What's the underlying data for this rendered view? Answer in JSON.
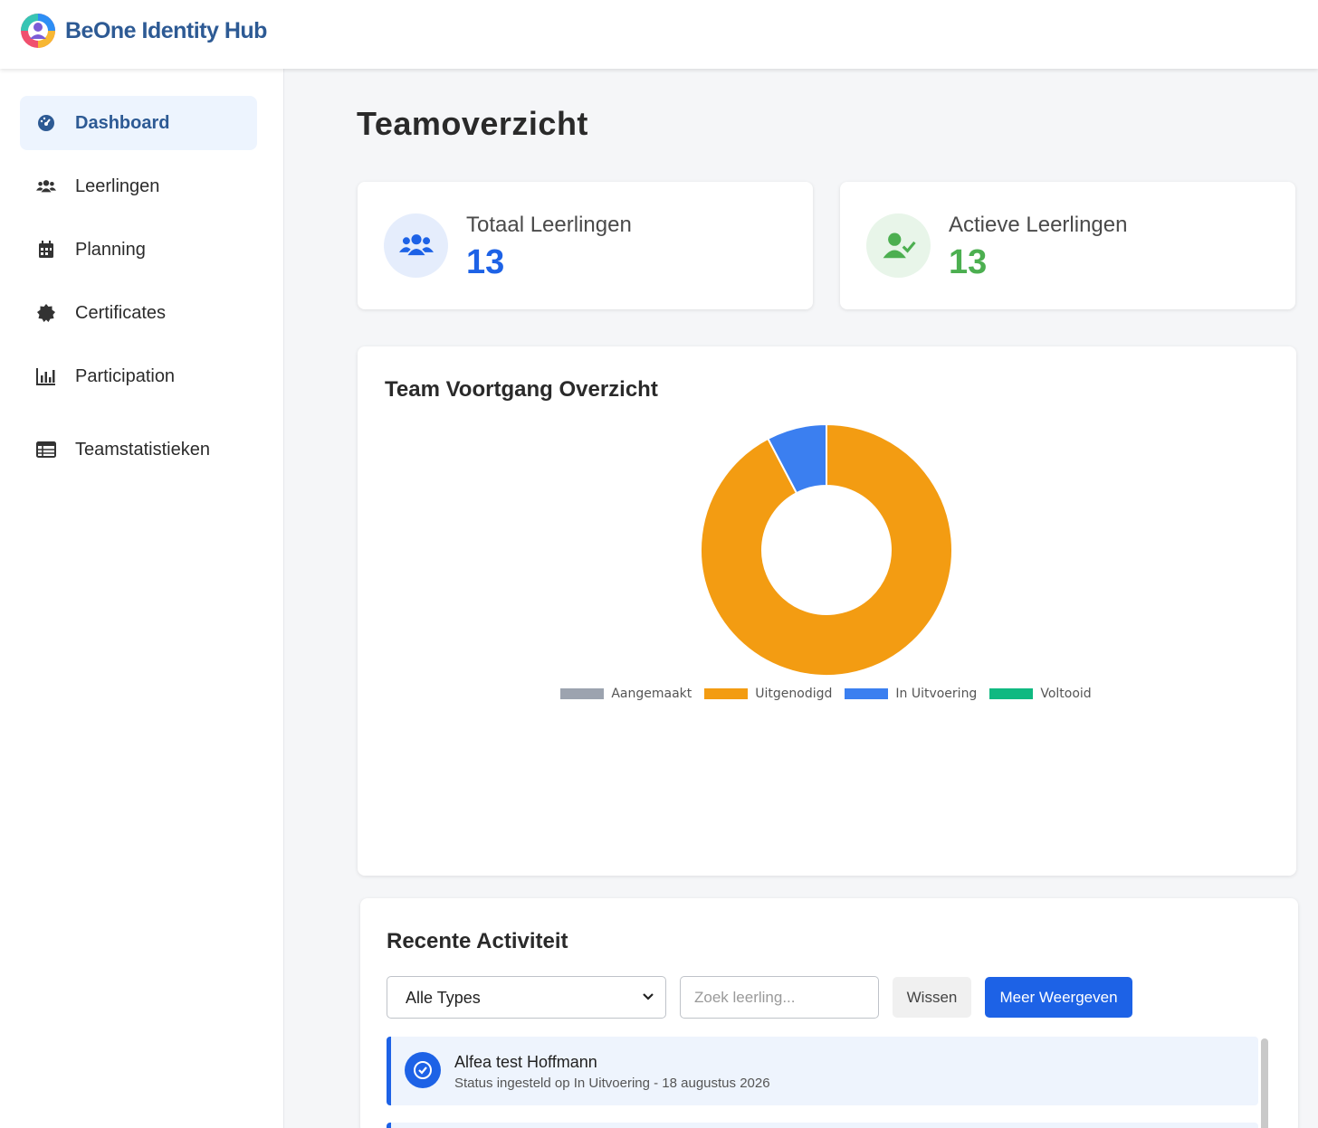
{
  "app": {
    "title": "BeOne Identity Hub"
  },
  "sidebar": {
    "items": [
      {
        "label": "Dashboard",
        "icon": "dashboard-gauge-icon",
        "active": true
      },
      {
        "label": "Leerlingen",
        "icon": "users-icon"
      },
      {
        "label": "Planning",
        "icon": "calendar-icon"
      },
      {
        "label": "Certificates",
        "icon": "certificate-badge-icon"
      },
      {
        "label": "Participation",
        "icon": "bar-chart-icon"
      },
      {
        "label": "Teamstatistieken",
        "icon": "table-icon"
      }
    ]
  },
  "page": {
    "title": "Teamoverzicht"
  },
  "stats": {
    "total": {
      "label": "Totaal Leerlingen",
      "value": "13",
      "color": "#1d62e6",
      "icon": "users-icon"
    },
    "active": {
      "label": "Actieve Leerlingen",
      "value": "13",
      "color": "#4caf50",
      "icon": "user-check-icon"
    }
  },
  "chart_data": {
    "type": "pie",
    "title": "Team Voortgang Overzicht",
    "categories": [
      "Aangemaakt",
      "Uitgenodigd",
      "In Uitvoering",
      "Voltooid"
    ],
    "values": [
      0,
      12,
      1,
      0
    ],
    "colors": [
      "#9ca3af",
      "#f39c12",
      "#3b7ff0",
      "#10b981"
    ],
    "donut": true,
    "legend": "bottom"
  },
  "activity": {
    "title": "Recente Activiteit",
    "filter": {
      "selected": "Alle Types"
    },
    "search": {
      "placeholder": "Zoek leerling..."
    },
    "clear_label": "Wissen",
    "more_label": "Meer Weergeven",
    "items": [
      {
        "name": "Alfea test Hoffmann",
        "description": "Status ingesteld op In Uitvoering - 18 augustus 2026",
        "icon": "check-circle-icon"
      }
    ]
  }
}
